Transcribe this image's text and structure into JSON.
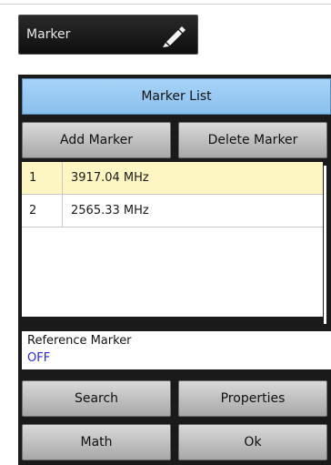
{
  "marker_button": {
    "label": "Marker",
    "icon": "pencil-icon"
  },
  "panel": {
    "title": "Marker List",
    "add_label": "Add Marker",
    "delete_label": "Delete Marker",
    "markers": [
      {
        "num": "1",
        "freq": "3917.04 MHz",
        "selected": true
      },
      {
        "num": "2",
        "freq": "2565.33 MHz",
        "selected": false
      }
    ],
    "reference_label": "Reference Marker",
    "reference_value": "OFF",
    "search_label": "Search",
    "properties_label": "Properties",
    "math_label": "Math",
    "ok_label": "Ok"
  },
  "colors": {
    "title_bar": "#9ccaf3",
    "selected_row": "#fdf6c2",
    "reference_value": "#2a2ad8"
  }
}
